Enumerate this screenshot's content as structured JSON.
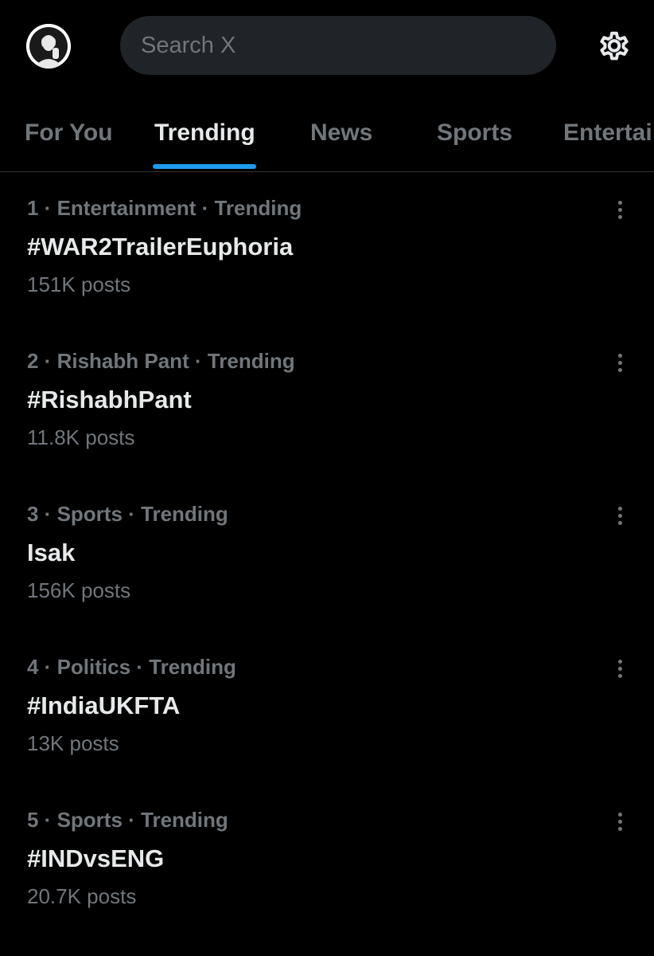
{
  "header": {
    "avatar_icon": "profile-avatar",
    "search_placeholder": "Search X",
    "settings_icon": "gear-icon"
  },
  "tabs": [
    {
      "label": "For You",
      "active": false
    },
    {
      "label": "Trending",
      "active": true
    },
    {
      "label": "News",
      "active": false
    },
    {
      "label": "Sports",
      "active": false
    },
    {
      "label": "Entertai",
      "active": false
    }
  ],
  "trends": [
    {
      "meta": "1 · Entertainment · Trending",
      "name": "#WAR2TrailerEuphoria",
      "count": "151K posts"
    },
    {
      "meta": "2 · Rishabh Pant · Trending",
      "name": "#RishabhPant",
      "count": "11.8K posts"
    },
    {
      "meta": "3 · Sports · Trending",
      "name": "Isak",
      "count": "156K posts"
    },
    {
      "meta": "4 · Politics · Trending",
      "name": "#IndiaUKFTA",
      "count": "13K posts"
    },
    {
      "meta": "5 · Sports · Trending",
      "name": "#INDvsENG",
      "count": "20.7K posts"
    }
  ],
  "colors": {
    "background": "#000000",
    "text_primary": "#e7e9ea",
    "text_secondary": "#71767b",
    "accent": "#1d9bf0",
    "search_bg": "#202327",
    "divider": "#2f3336"
  }
}
